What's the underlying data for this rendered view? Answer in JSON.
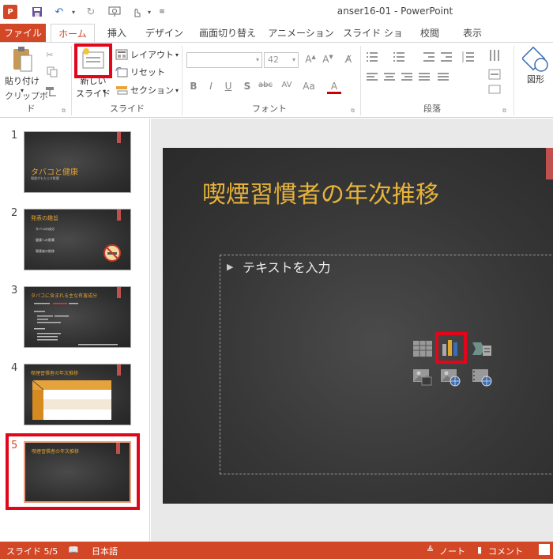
{
  "window": {
    "title": "anser16-01 - PowerPoint"
  },
  "quick_access": {
    "app_icon": "powerpoint-icon",
    "items": [
      "save-icon",
      "undo-icon",
      "redo-icon",
      "touch-mode-icon",
      "customize-icon"
    ]
  },
  "tabs": [
    "ファイル",
    "ホーム",
    "挿入",
    "デザイン",
    "画面切り替え",
    "アニメーション",
    "スライド ショー",
    "校閲",
    "表示"
  ],
  "ribbon": {
    "clipboard": {
      "paste": "貼り付け",
      "label": "クリップボード"
    },
    "slides": {
      "new_slide_line1": "新しい",
      "new_slide_line2": "スライド",
      "layout": "レイアウト",
      "reset": "リセット",
      "section": "セクション",
      "label": "スライド"
    },
    "font": {
      "name": "",
      "size": "42",
      "label": "フォント",
      "bold": "B",
      "italic": "I",
      "underline": "U",
      "shadow": "S",
      "strike": "abc",
      "spacing": "AV",
      "case": "Aa",
      "color": "A"
    },
    "paragraph": {
      "label": "段落"
    },
    "drawing": {
      "shapes": "図形"
    }
  },
  "thumbnails": [
    {
      "num": "1",
      "title": "タバコと健康",
      "sub": "喫煙がもたらす影響"
    },
    {
      "num": "2",
      "title": "発表の趣旨",
      "bullets": [
        "タバコの成分",
        "健康への影響",
        "喫煙者の推移"
      ]
    },
    {
      "num": "3",
      "title": "タバコに含まれる主な有害成分"
    },
    {
      "num": "4",
      "title": "喫煙習慣者の年次推移"
    },
    {
      "num": "5",
      "title": "喫煙習慣者の年次推移"
    }
  ],
  "slide": {
    "title": "喫煙習慣者の年次推移",
    "placeholder": "テキストを入力"
  },
  "status": {
    "slide": "スライド 5/5",
    "language": "日本語",
    "notes": "ノート",
    "comments": "コメント"
  },
  "colors": {
    "accent": "#d24726",
    "title_text": "#e8b33a",
    "highlight": "#e3061a"
  }
}
